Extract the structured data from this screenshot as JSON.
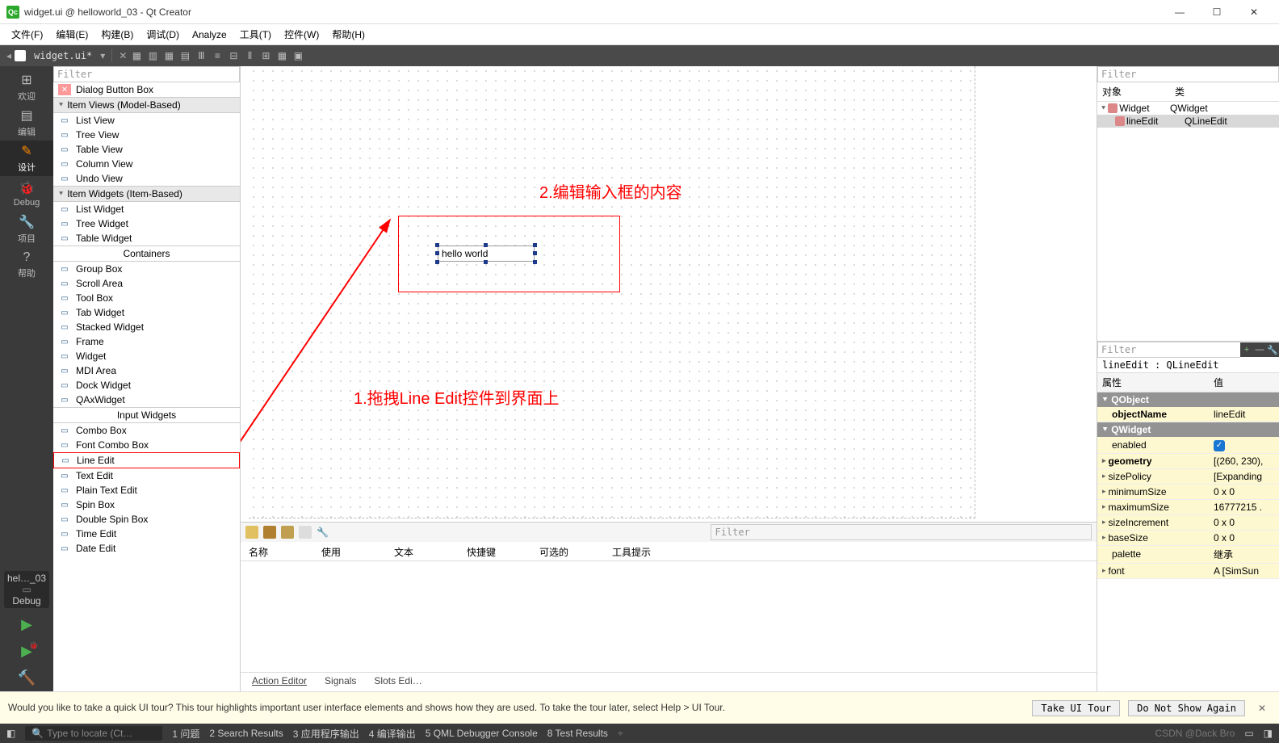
{
  "title": "widget.ui @ helloworld_03 - Qt Creator",
  "menus": [
    "文件(F)",
    "编辑(E)",
    "构建(B)",
    "调试(D)",
    "Analyze",
    "工具(T)",
    "控件(W)",
    "帮助(H)"
  ],
  "open_file": "widget.ui*",
  "leftbar": [
    {
      "icon": "⊞",
      "label": "欢迎"
    },
    {
      "icon": "▤",
      "label": "编辑"
    },
    {
      "icon": "✎",
      "label": "设计"
    },
    {
      "icon": "🐞",
      "label": "Debug"
    },
    {
      "icon": "🔧",
      "label": "项目"
    },
    {
      "icon": "?",
      "label": "帮助"
    }
  ],
  "target_label": "hel…_03",
  "debug_label": "Debug",
  "widget_box": {
    "filter_placeholder": "Filter",
    "groups": [
      {
        "header_raw": "Dialog Button Box",
        "pre": true
      },
      {
        "header": "Item Views (Model-Based)",
        "items": [
          "List View",
          "Tree View",
          "Table View",
          "Column View",
          "Undo View"
        ]
      },
      {
        "header": "Item Widgets (Item-Based)",
        "items": [
          "List Widget",
          "Tree Widget",
          "Table Widget"
        ]
      },
      {
        "header_center": "Containers",
        "items": [
          "Group Box",
          "Scroll Area",
          "Tool Box",
          "Tab Widget",
          "Stacked Widget",
          "Frame",
          "Widget",
          "MDI Area",
          "Dock Widget",
          "QAxWidget"
        ]
      },
      {
        "header_center": "Input Widgets",
        "items": [
          "Combo Box",
          "Font Combo Box",
          "Line Edit",
          "Text Edit",
          "Plain Text Edit",
          "Spin Box",
          "Double Spin Box",
          "Time Edit",
          "Date Edit"
        ]
      }
    ]
  },
  "canvas": {
    "lineedit_text": "hello world",
    "annotation1": "2.编辑输入框的内容",
    "annotation2": "1.拖拽Line Edit控件到界面上"
  },
  "action_panel": {
    "filter_placeholder": "Filter",
    "columns": [
      "名称",
      "使用",
      "文本",
      "快捷键",
      "可选的",
      "工具提示"
    ],
    "tabs": [
      "Action Editor",
      "Signals",
      "Slots Edi…"
    ]
  },
  "object_inspector": {
    "filter_placeholder": "Filter",
    "columns": [
      "对象",
      "类"
    ],
    "rows": [
      {
        "name": "Widget",
        "cls": "QWidget",
        "indent": 0
      },
      {
        "name": "lineEdit",
        "cls": "QLineEdit",
        "indent": 1,
        "selected": true
      }
    ]
  },
  "property_editor": {
    "filter_placeholder": "Filter",
    "title": "lineEdit : QLineEdit",
    "columns": [
      "属性",
      "值"
    ],
    "groups": [
      {
        "name": "QObject",
        "rows": [
          {
            "k": "objectName",
            "v": "lineEdit",
            "bold": true
          }
        ]
      },
      {
        "name": "QWidget",
        "rows": [
          {
            "k": "enabled",
            "v": "check"
          },
          {
            "k": "geometry",
            "v": "[(260, 230),",
            "bold": true,
            "exp": true
          },
          {
            "k": "sizePolicy",
            "v": "[Expanding",
            "exp": true
          },
          {
            "k": "minimumSize",
            "v": "0 x 0",
            "exp": true
          },
          {
            "k": "maximumSize",
            "v": "16777215 .",
            "exp": true
          },
          {
            "k": "sizeIncrement",
            "v": "0 x 0",
            "exp": true
          },
          {
            "k": "baseSize",
            "v": "0 x 0",
            "exp": true
          },
          {
            "k": "palette",
            "v": "继承"
          },
          {
            "k": "font",
            "v": "A [SimSun",
            "exp": true
          }
        ]
      }
    ]
  },
  "infobar": {
    "msg": "Would you like to take a quick UI tour? This tour highlights important user interface elements and shows how they are used. To take the tour later, select Help > UI Tour.",
    "btn1": "Take UI Tour",
    "btn2": "Do Not Show Again"
  },
  "statusbar": {
    "search_placeholder": "Type to locate (Ct…",
    "items": [
      "1 问题",
      "2 Search Results",
      "3 应用程序输出",
      "4 编译输出",
      "5 QML Debugger Console",
      "8 Test Results"
    ],
    "watermark": "CSDN @Dack Bro"
  }
}
